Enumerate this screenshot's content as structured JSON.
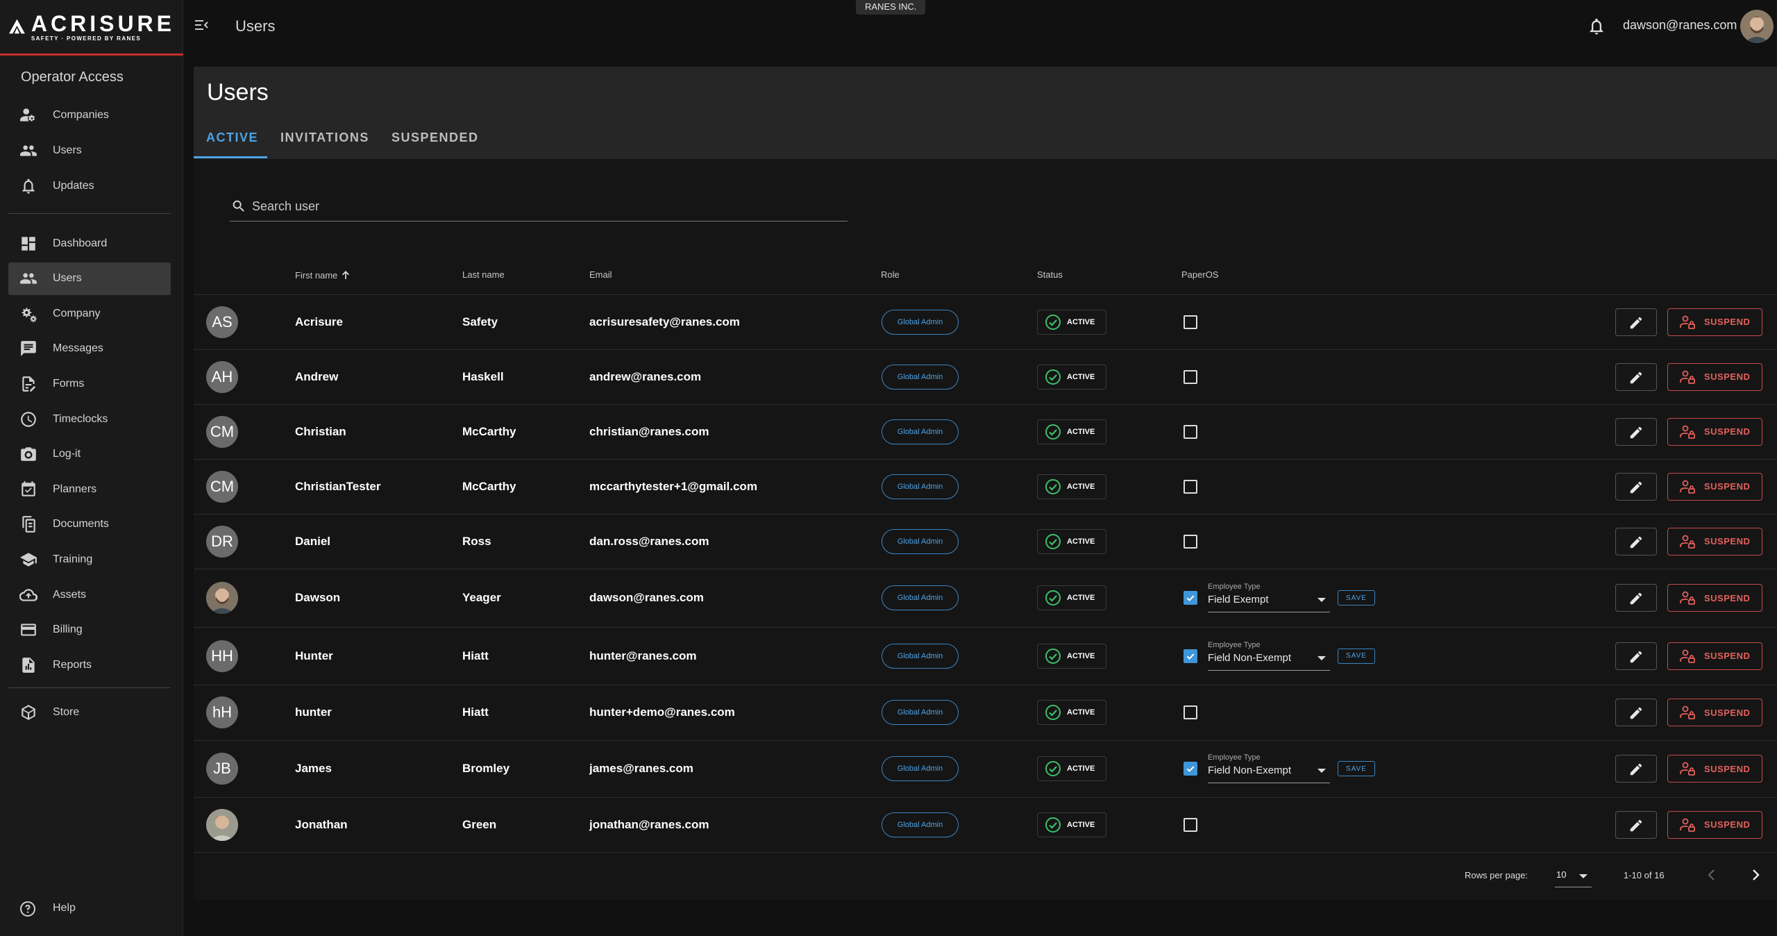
{
  "brand": {
    "name": "ACRISURE",
    "tagline": "SAFETY · POWERED BY RANES",
    "accent": "#c8302b"
  },
  "tenant": "RANES INC.",
  "header": {
    "breadcrumb": "Users",
    "user_email": "dawson@ranes.com"
  },
  "sidebar": {
    "section_title": "Operator Access",
    "operator_items": [
      {
        "label": "Companies",
        "icon": "user-gear-icon"
      },
      {
        "label": "Users",
        "icon": "users-icon"
      },
      {
        "label": "Updates",
        "icon": "bell-icon"
      }
    ],
    "items": [
      {
        "label": "Dashboard",
        "icon": "dashboard-icon"
      },
      {
        "label": "Users",
        "icon": "users-icon",
        "active": true
      },
      {
        "label": "Company",
        "icon": "gears-icon"
      },
      {
        "label": "Messages",
        "icon": "message-icon"
      },
      {
        "label": "Forms",
        "icon": "form-icon"
      },
      {
        "label": "Timeclocks",
        "icon": "clock-icon"
      },
      {
        "label": "Log-it",
        "icon": "camera-icon"
      },
      {
        "label": "Planners",
        "icon": "calendar-check-icon"
      },
      {
        "label": "Documents",
        "icon": "documents-icon"
      },
      {
        "label": "Training",
        "icon": "school-icon"
      },
      {
        "label": "Assets",
        "icon": "cloud-icon"
      },
      {
        "label": "Billing",
        "icon": "credit-card-icon"
      },
      {
        "label": "Reports",
        "icon": "report-icon"
      }
    ],
    "store_label": "Store",
    "help_label": "Help"
  },
  "page": {
    "title": "Users",
    "tabs": [
      "ACTIVE",
      "INVITATIONS",
      "SUSPENDED"
    ],
    "active_tab": "ACTIVE",
    "search_placeholder": "Search user"
  },
  "table": {
    "columns": {
      "first_name": "First name",
      "last_name": "Last name",
      "email": "Email",
      "role": "Role",
      "status": "Status",
      "paperos": "PaperOS"
    },
    "sort": {
      "column": "first_name",
      "direction": "asc"
    },
    "employee_type_label": "Employee Type",
    "save_label": "SAVE",
    "suspend_label": "SUSPEND",
    "rows": [
      {
        "initials": "AS",
        "photo": false,
        "first": "Acrisure",
        "last": "Safety",
        "email": "acrisuresafety@ranes.com",
        "role": "Global Admin",
        "status": "ACTIVE",
        "paperos": false,
        "employee_type": ""
      },
      {
        "initials": "AH",
        "photo": false,
        "first": "Andrew",
        "last": "Haskell",
        "email": "andrew@ranes.com",
        "role": "Global Admin",
        "status": "ACTIVE",
        "paperos": false,
        "employee_type": ""
      },
      {
        "initials": "CM",
        "photo": false,
        "first": "Christian",
        "last": "McCarthy",
        "email": "christian@ranes.com",
        "role": "Global Admin",
        "status": "ACTIVE",
        "paperos": false,
        "employee_type": ""
      },
      {
        "initials": "CM",
        "photo": false,
        "first": "ChristianTester",
        "last": "McCarthy",
        "email": "mccarthytester+1@gmail.com",
        "role": "Global Admin",
        "status": "ACTIVE",
        "paperos": false,
        "employee_type": ""
      },
      {
        "initials": "DR",
        "photo": false,
        "first": "Daniel",
        "last": "Ross",
        "email": "dan.ross@ranes.com",
        "role": "Global Admin",
        "status": "ACTIVE",
        "paperos": false,
        "employee_type": ""
      },
      {
        "initials": "",
        "photo": true,
        "first": "Dawson",
        "last": "Yeager",
        "email": "dawson@ranes.com",
        "role": "Global Admin",
        "status": "ACTIVE",
        "paperos": true,
        "employee_type": "Field Exempt"
      },
      {
        "initials": "HH",
        "photo": false,
        "first": "Hunter",
        "last": "Hiatt",
        "email": "hunter@ranes.com",
        "role": "Global Admin",
        "status": "ACTIVE",
        "paperos": true,
        "employee_type": "Field Non-Exempt"
      },
      {
        "initials": "hH",
        "photo": false,
        "first": "hunter",
        "last": "Hiatt",
        "email": "hunter+demo@ranes.com",
        "role": "Global Admin",
        "status": "ACTIVE",
        "paperos": false,
        "employee_type": ""
      },
      {
        "initials": "JB",
        "photo": false,
        "first": "James",
        "last": "Bromley",
        "email": "james@ranes.com",
        "role": "Global Admin",
        "status": "ACTIVE",
        "paperos": true,
        "employee_type": "Field Non-Exempt"
      },
      {
        "initials": "",
        "photo": true,
        "first": "Jonathan",
        "last": "Green",
        "email": "jonathan@ranes.com",
        "role": "Global Admin",
        "status": "ACTIVE",
        "paperos": false,
        "employee_type": ""
      }
    ]
  },
  "pagination": {
    "rows_per_page_label": "Rows per page:",
    "rows_per_page": "10",
    "range": "1-10 of 16"
  }
}
